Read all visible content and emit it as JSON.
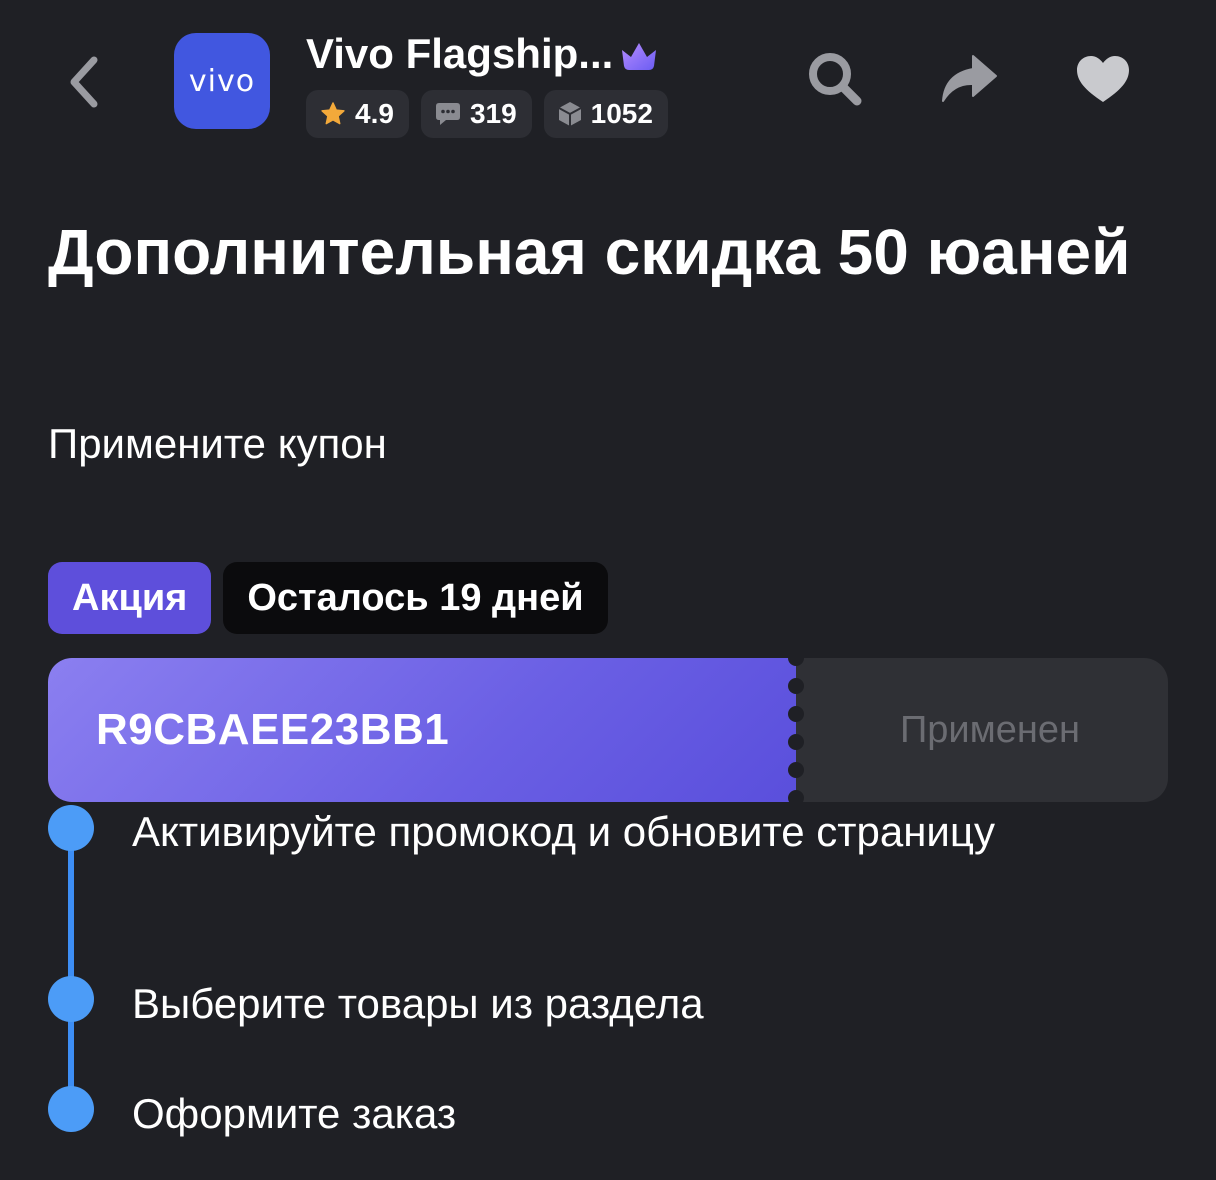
{
  "header": {
    "store_name": "Vivo Flagship...",
    "logo_text": "vivo",
    "rating": "4.9",
    "comments": "319",
    "orders": "1052"
  },
  "promo": {
    "title": "Дополнительная скидка 50 юаней",
    "subtitle": "Примените купон"
  },
  "tags": {
    "promo": "Акция",
    "remaining": "Осталось 19 дней"
  },
  "coupon": {
    "code": "R9CBAEE23BB1",
    "status": "Применен"
  },
  "steps": [
    {
      "text": "Активируйте промокод и обновите страницу"
    },
    {
      "text": "Выберите товары из раздела"
    },
    {
      "text": "Оформите заказ"
    }
  ],
  "colors": {
    "background": "#1f2025",
    "accent": "#5e4fdb",
    "step_blue": "#4c9cf7",
    "logo_blue": "#4157e0",
    "star": "#f3a93a"
  },
  "icons": {
    "back": "chevron-left-icon",
    "search": "search-icon",
    "share": "share-icon",
    "favorite": "heart-icon",
    "crown": "crown-icon",
    "rating": "star-icon",
    "comments": "comment-icon",
    "orders": "box-icon"
  }
}
